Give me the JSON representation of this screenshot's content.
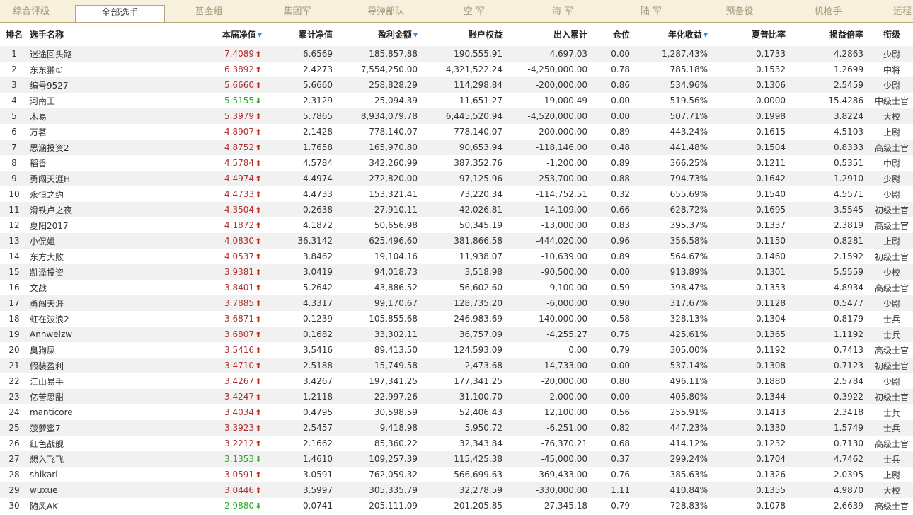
{
  "tabs": [
    {
      "label": "综合评级",
      "active": false
    },
    {
      "label": "全部选手",
      "active": true
    },
    {
      "label": "基金组",
      "active": false
    },
    {
      "label": "集团军",
      "active": false
    },
    {
      "label": "导弹部队",
      "active": false
    },
    {
      "label": "空 军",
      "active": false
    },
    {
      "label": "海 军",
      "active": false
    },
    {
      "label": "陆 军",
      "active": false
    },
    {
      "label": "预备役",
      "active": false
    },
    {
      "label": "机枪手",
      "active": false
    },
    {
      "label": "远程",
      "active": false
    }
  ],
  "columns": [
    {
      "key": "rank",
      "label": "排名",
      "sortable": false
    },
    {
      "key": "name",
      "label": "选手名称",
      "sortable": false
    },
    {
      "key": "nav",
      "label": "本届净值",
      "sortable": true
    },
    {
      "key": "cum_nav",
      "label": "累计净值",
      "sortable": false
    },
    {
      "key": "profit",
      "label": "盈利金额",
      "sortable": true
    },
    {
      "key": "equity",
      "label": "账户权益",
      "sortable": false
    },
    {
      "key": "flow",
      "label": "出入累计",
      "sortable": false
    },
    {
      "key": "position",
      "label": "仓位",
      "sortable": false
    },
    {
      "key": "annual",
      "label": "年化收益",
      "sortable": true
    },
    {
      "key": "sharpe",
      "label": "夏普比率",
      "sortable": false
    },
    {
      "key": "pl_ratio",
      "label": "损益倍率",
      "sortable": false
    },
    {
      "key": "title",
      "label": "衔级",
      "sortable": false
    }
  ],
  "sort_icon": "sort-down-icon",
  "colors": {
    "up": "#c0281e",
    "down": "#2ea82e",
    "sort": "#3a8fd6",
    "tab_bg": "#f6f0dc"
  },
  "rows": [
    {
      "rank": "1",
      "name": "迷途回头路",
      "nav": "7.4089",
      "trend": "up",
      "cum_nav": "6.6569",
      "profit": "185,857.88",
      "equity": "190,555.91",
      "flow": "4,697.03",
      "position": "0.00",
      "annual": "1,287.43%",
      "sharpe": "0.1733",
      "pl_ratio": "4.2863",
      "title": "少尉"
    },
    {
      "rank": "2",
      "name": "东东翀①",
      "nav": "6.3892",
      "trend": "up",
      "cum_nav": "2.4273",
      "profit": "7,554,250.00",
      "equity": "4,321,522.24",
      "flow": "-4,250,000.00",
      "position": "0.78",
      "annual": "785.18%",
      "sharpe": "0.1532",
      "pl_ratio": "1.2699",
      "title": "中将"
    },
    {
      "rank": "3",
      "name": "编号9527",
      "nav": "5.6660",
      "trend": "up",
      "cum_nav": "5.6660",
      "profit": "258,828.29",
      "equity": "114,298.84",
      "flow": "-200,000.00",
      "position": "0.86",
      "annual": "534.96%",
      "sharpe": "0.1306",
      "pl_ratio": "2.5459",
      "title": "少尉"
    },
    {
      "rank": "4",
      "name": "河南王",
      "nav": "5.5155",
      "trend": "down",
      "cum_nav": "2.3129",
      "profit": "25,094.39",
      "equity": "11,651.27",
      "flow": "-19,000.49",
      "position": "0.00",
      "annual": "519.56%",
      "sharpe": "0.0000",
      "pl_ratio": "15.4286",
      "title": "中级士官"
    },
    {
      "rank": "5",
      "name": "木易",
      "nav": "5.3979",
      "trend": "up",
      "cum_nav": "5.7865",
      "profit": "8,934,079.78",
      "equity": "6,445,520.94",
      "flow": "-4,520,000.00",
      "position": "0.00",
      "annual": "507.71%",
      "sharpe": "0.1998",
      "pl_ratio": "3.8224",
      "title": "大校"
    },
    {
      "rank": "6",
      "name": "万茗",
      "nav": "4.8907",
      "trend": "up",
      "cum_nav": "2.1428",
      "profit": "778,140.07",
      "equity": "778,140.07",
      "flow": "-200,000.00",
      "position": "0.89",
      "annual": "443.24%",
      "sharpe": "0.1615",
      "pl_ratio": "4.5103",
      "title": "上尉"
    },
    {
      "rank": "7",
      "name": "思涵投资2",
      "nav": "4.8752",
      "trend": "up",
      "cum_nav": "1.7658",
      "profit": "165,970.80",
      "equity": "90,653.94",
      "flow": "-118,146.00",
      "position": "0.48",
      "annual": "441.48%",
      "sharpe": "0.1504",
      "pl_ratio": "0.8333",
      "title": "高级士官"
    },
    {
      "rank": "8",
      "name": "稻香",
      "nav": "4.5784",
      "trend": "up",
      "cum_nav": "4.5784",
      "profit": "342,260.99",
      "equity": "387,352.76",
      "flow": "-1,200.00",
      "position": "0.89",
      "annual": "366.25%",
      "sharpe": "0.1211",
      "pl_ratio": "0.5351",
      "title": "中尉"
    },
    {
      "rank": "9",
      "name": "勇闯天涯H",
      "nav": "4.4974",
      "trend": "up",
      "cum_nav": "4.4974",
      "profit": "272,820.00",
      "equity": "97,125.96",
      "flow": "-253,700.00",
      "position": "0.88",
      "annual": "794.73%",
      "sharpe": "0.1642",
      "pl_ratio": "1.2910",
      "title": "少尉"
    },
    {
      "rank": "10",
      "name": "永恒之约",
      "nav": "4.4733",
      "trend": "up",
      "cum_nav": "4.4733",
      "profit": "153,321.41",
      "equity": "73,220.34",
      "flow": "-114,752.51",
      "position": "0.32",
      "annual": "655.69%",
      "sharpe": "0.1540",
      "pl_ratio": "4.5571",
      "title": "少尉"
    },
    {
      "rank": "11",
      "name": "滑铁卢之夜",
      "nav": "4.3504",
      "trend": "up",
      "cum_nav": "0.2638",
      "profit": "27,910.11",
      "equity": "42,026.81",
      "flow": "14,109.00",
      "position": "0.66",
      "annual": "628.72%",
      "sharpe": "0.1695",
      "pl_ratio": "3.5545",
      "title": "初级士官"
    },
    {
      "rank": "12",
      "name": "夏阳2017",
      "nav": "4.1872",
      "trend": "up",
      "cum_nav": "4.1872",
      "profit": "50,656.98",
      "equity": "50,345.19",
      "flow": "-13,000.00",
      "position": "0.83",
      "annual": "395.37%",
      "sharpe": "0.1337",
      "pl_ratio": "2.3819",
      "title": "高级士官"
    },
    {
      "rank": "13",
      "name": "小侃姐",
      "nav": "4.0830",
      "trend": "up",
      "cum_nav": "36.3142",
      "profit": "625,496.60",
      "equity": "381,866.58",
      "flow": "-444,020.00",
      "position": "0.96",
      "annual": "356.58%",
      "sharpe": "0.1150",
      "pl_ratio": "0.8281",
      "title": "上尉"
    },
    {
      "rank": "14",
      "name": "东方大败",
      "nav": "4.0537",
      "trend": "up",
      "cum_nav": "3.8462",
      "profit": "19,104.16",
      "equity": "11,938.07",
      "flow": "-10,639.00",
      "position": "0.89",
      "annual": "564.67%",
      "sharpe": "0.1460",
      "pl_ratio": "2.1592",
      "title": "初级士官"
    },
    {
      "rank": "15",
      "name": "凯泽投资",
      "nav": "3.9381",
      "trend": "up",
      "cum_nav": "3.0419",
      "profit": "94,018.73",
      "equity": "3,518.98",
      "flow": "-90,500.00",
      "position": "0.00",
      "annual": "913.89%",
      "sharpe": "0.1301",
      "pl_ratio": "5.5559",
      "title": "少校"
    },
    {
      "rank": "16",
      "name": "文战",
      "nav": "3.8401",
      "trend": "up",
      "cum_nav": "5.2642",
      "profit": "43,886.52",
      "equity": "56,602.60",
      "flow": "9,100.00",
      "position": "0.59",
      "annual": "398.47%",
      "sharpe": "0.1353",
      "pl_ratio": "4.8934",
      "title": "高级士官"
    },
    {
      "rank": "17",
      "name": "勇闯天涯",
      "nav": "3.7885",
      "trend": "up",
      "cum_nav": "4.3317",
      "profit": "99,170.67",
      "equity": "128,735.20",
      "flow": "-6,000.00",
      "position": "0.90",
      "annual": "317.67%",
      "sharpe": "0.1128",
      "pl_ratio": "0.5477",
      "title": "少尉"
    },
    {
      "rank": "18",
      "name": "虹在波浪2",
      "nav": "3.6871",
      "trend": "up",
      "cum_nav": "0.1239",
      "profit": "105,855.68",
      "equity": "246,983.69",
      "flow": "140,000.00",
      "position": "0.58",
      "annual": "328.13%",
      "sharpe": "0.1304",
      "pl_ratio": "0.8179",
      "title": "士兵"
    },
    {
      "rank": "19",
      "name": "Annweizw",
      "nav": "3.6807",
      "trend": "up",
      "cum_nav": "0.1682",
      "profit": "33,302.11",
      "equity": "36,757.09",
      "flow": "-4,255.27",
      "position": "0.75",
      "annual": "425.61%",
      "sharpe": "0.1365",
      "pl_ratio": "1.1192",
      "title": "士兵"
    },
    {
      "rank": "20",
      "name": "臭狗屎",
      "nav": "3.5416",
      "trend": "up",
      "cum_nav": "3.5416",
      "profit": "89,413.50",
      "equity": "124,593.09",
      "flow": "0.00",
      "position": "0.79",
      "annual": "305.00%",
      "sharpe": "0.1192",
      "pl_ratio": "0.7413",
      "title": "高级士官"
    },
    {
      "rank": "21",
      "name": "假装盈利",
      "nav": "3.4710",
      "trend": "up",
      "cum_nav": "2.5188",
      "profit": "15,749.58",
      "equity": "2,473.68",
      "flow": "-14,733.00",
      "position": "0.00",
      "annual": "537.14%",
      "sharpe": "0.1308",
      "pl_ratio": "0.7123",
      "title": "初级士官"
    },
    {
      "rank": "22",
      "name": "江山易手",
      "nav": "3.4267",
      "trend": "up",
      "cum_nav": "3.4267",
      "profit": "197,341.25",
      "equity": "177,341.25",
      "flow": "-20,000.00",
      "position": "0.80",
      "annual": "496.11%",
      "sharpe": "0.1880",
      "pl_ratio": "2.5784",
      "title": "少尉"
    },
    {
      "rank": "23",
      "name": "亿苦思甜",
      "nav": "3.4247",
      "trend": "up",
      "cum_nav": "1.2118",
      "profit": "22,997.26",
      "equity": "31,100.70",
      "flow": "-2,000.00",
      "position": "0.00",
      "annual": "405.80%",
      "sharpe": "0.1344",
      "pl_ratio": "0.3922",
      "title": "初级士官"
    },
    {
      "rank": "24",
      "name": "manticore",
      "nav": "3.4034",
      "trend": "up",
      "cum_nav": "0.4795",
      "profit": "30,598.59",
      "equity": "52,406.43",
      "flow": "12,100.00",
      "position": "0.56",
      "annual": "255.91%",
      "sharpe": "0.1413",
      "pl_ratio": "2.3418",
      "title": "士兵"
    },
    {
      "rank": "25",
      "name": "菠萝蜜7",
      "nav": "3.3923",
      "trend": "up",
      "cum_nav": "2.5457",
      "profit": "9,418.98",
      "equity": "5,950.72",
      "flow": "-6,251.00",
      "position": "0.82",
      "annual": "447.23%",
      "sharpe": "0.1330",
      "pl_ratio": "1.5749",
      "title": "士兵"
    },
    {
      "rank": "26",
      "name": "红色战舰",
      "nav": "3.2212",
      "trend": "up",
      "cum_nav": "2.1662",
      "profit": "85,360.22",
      "equity": "32,343.84",
      "flow": "-76,370.21",
      "position": "0.68",
      "annual": "414.12%",
      "sharpe": "0.1232",
      "pl_ratio": "0.7130",
      "title": "高级士官"
    },
    {
      "rank": "27",
      "name": "想入飞飞",
      "nav": "3.1353",
      "trend": "down",
      "cum_nav": "1.4610",
      "profit": "109,257.39",
      "equity": "115,425.38",
      "flow": "-45,000.00",
      "position": "0.37",
      "annual": "299.24%",
      "sharpe": "0.1704",
      "pl_ratio": "4.7462",
      "title": "士兵"
    },
    {
      "rank": "28",
      "name": "shikari",
      "nav": "3.0591",
      "trend": "up",
      "cum_nav": "3.0591",
      "profit": "762,059.32",
      "equity": "566,699.63",
      "flow": "-369,433.00",
      "position": "0.76",
      "annual": "385.63%",
      "sharpe": "0.1326",
      "pl_ratio": "2.0395",
      "title": "上尉"
    },
    {
      "rank": "29",
      "name": "wuxue",
      "nav": "3.0446",
      "trend": "up",
      "cum_nav": "3.5997",
      "profit": "305,335.79",
      "equity": "32,278.59",
      "flow": "-330,000.00",
      "position": "1.11",
      "annual": "410.84%",
      "sharpe": "0.1355",
      "pl_ratio": "4.9870",
      "title": "大校"
    },
    {
      "rank": "30",
      "name": "随风AK",
      "nav": "2.9880",
      "trend": "down",
      "cum_nav": "0.0741",
      "profit": "205,111.09",
      "equity": "201,205.85",
      "flow": "-27,345.18",
      "position": "0.79",
      "annual": "728.83%",
      "sharpe": "0.1078",
      "pl_ratio": "2.6639",
      "title": "高级士官"
    }
  ]
}
